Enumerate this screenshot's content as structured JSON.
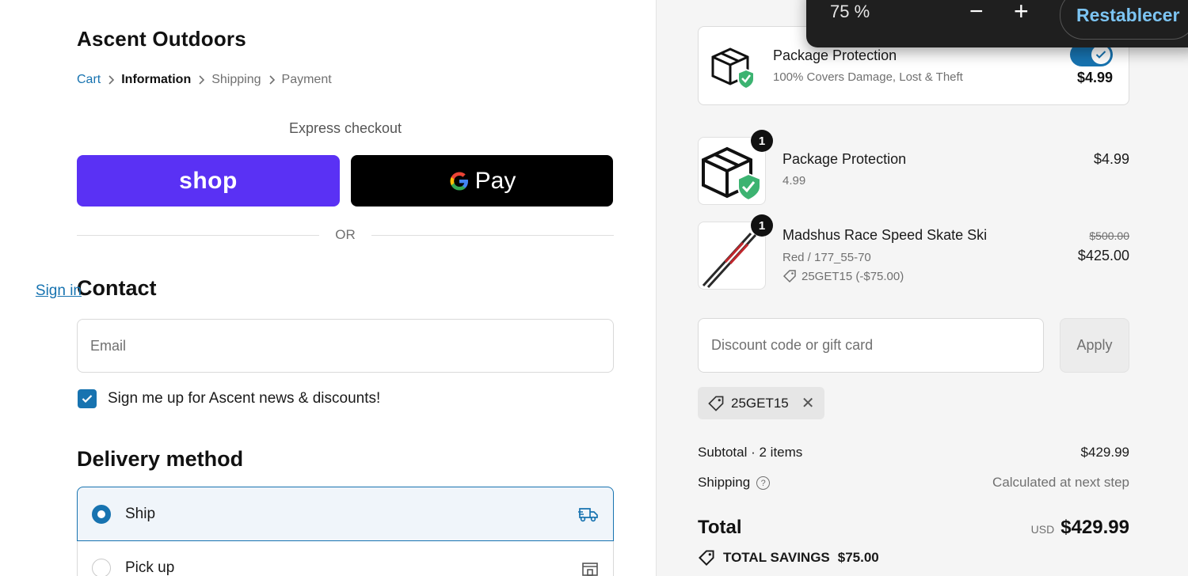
{
  "store": {
    "name": "Ascent Outdoors"
  },
  "breadcrumb": {
    "items": [
      {
        "label": "Cart",
        "state": "link"
      },
      {
        "label": "Information",
        "state": "current"
      },
      {
        "label": "Shipping",
        "state": "pending"
      },
      {
        "label": "Payment",
        "state": "pending"
      }
    ],
    "separator_icon": "chevron-right-icon"
  },
  "express": {
    "label": "Express checkout",
    "shop_label": "shop",
    "gpay_label": "Pay",
    "or_label": "OR"
  },
  "contact": {
    "title": "Contact",
    "signin_label": "Sign in",
    "email_placeholder": "Email",
    "newsletter_label": "Sign me up for Ascent news & discounts!",
    "newsletter_checked": true
  },
  "delivery": {
    "title": "Delivery method",
    "options": [
      {
        "label": "Ship",
        "selected": true,
        "icon": "truck-icon"
      },
      {
        "label": "Pick up",
        "selected": false,
        "icon": "store-icon"
      }
    ]
  },
  "zoom": {
    "level": "75 %",
    "reset_label": "Restablecer"
  },
  "protection_card": {
    "title": "Package Protection",
    "subtitle": "100% Covers Damage, Lost & Theft",
    "price": "$4.99",
    "enabled": true
  },
  "line_items": [
    {
      "name": "Package Protection",
      "variant": "4.99",
      "qty": "1",
      "price": "$4.99",
      "old_price": "",
      "discount": ""
    },
    {
      "name": "Madshus Race Speed Skate Ski",
      "variant": "Red / 177_55-70",
      "qty": "1",
      "price": "$425.00",
      "old_price": "$500.00",
      "discount": "25GET15 (-$75.00)"
    }
  ],
  "discount": {
    "placeholder": "Discount code or gift card",
    "apply_label": "Apply",
    "applied_code": "25GET15"
  },
  "summary": {
    "subtotal_label": "Subtotal · 2 items",
    "subtotal_value": "$429.99",
    "shipping_label": "Shipping",
    "shipping_value": "Calculated at next step",
    "total_label": "Total",
    "total_currency": "USD",
    "total_value": "$429.99",
    "savings_label": "TOTAL SAVINGS",
    "savings_value": "$75.00"
  },
  "colors": {
    "accent": "#1773b0",
    "shop_pay": "#5a31f4",
    "gpay": "#000000",
    "shield_green": "#3cb371"
  }
}
